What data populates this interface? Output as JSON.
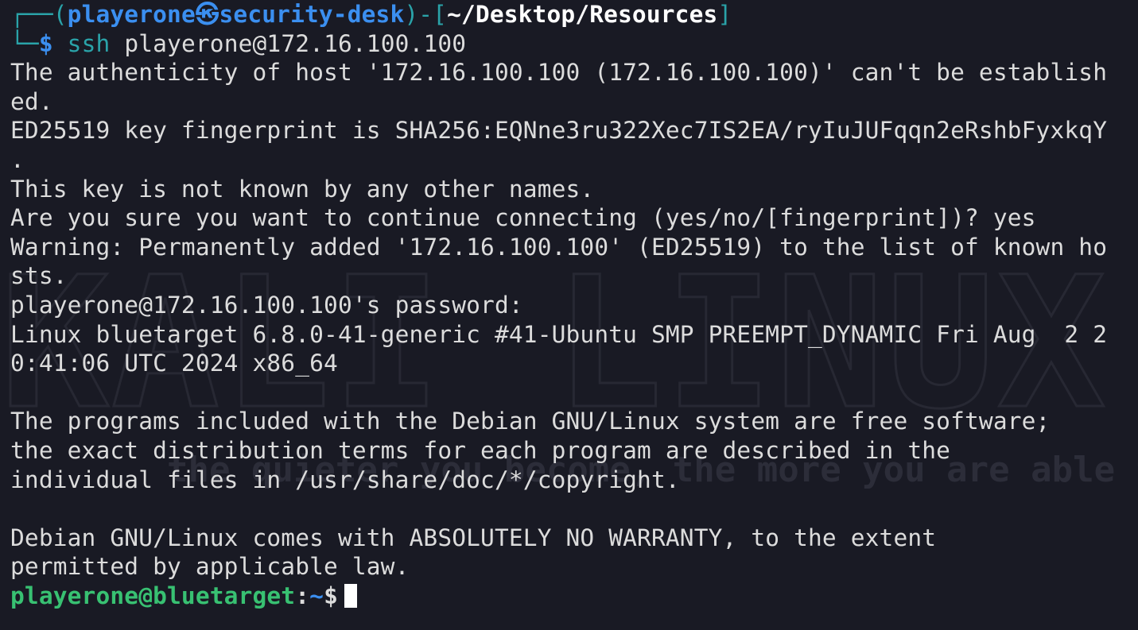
{
  "background_watermark": {
    "logo_text": "KALI LINUX",
    "tagline_text": "the quieter you become, the more you are able to hear"
  },
  "prompt": {
    "box_open": "┌──(",
    "user": "playerone",
    "skull": "㉿",
    "host": "security-desk",
    "box_mid": ")-[",
    "path": "~/Desktop/Resources",
    "box_close": "]",
    "box_bottom": "└─",
    "dollar": "$",
    "command_name": "ssh",
    "command_args": "playerone@172.16.100.100"
  },
  "output_lines": [
    "The authenticity of host '172.16.100.100 (172.16.100.100)' can't be establish",
    "ed.",
    "ED25519 key fingerprint is SHA256:EQNne3ru322Xec7IS2EA/ryIuJUFqqn2eRshbFyxkqY",
    ".",
    "This key is not known by any other names.",
    "Are you sure you want to continue connecting (yes/no/[fingerprint])? yes",
    "Warning: Permanently added '172.16.100.100' (ED25519) to the list of known ho",
    "sts.",
    "playerone@172.16.100.100's password:",
    "Linux bluetarget 6.8.0-41-generic #41-Ubuntu SMP PREEMPT_DYNAMIC Fri Aug  2 2",
    "0:41:06 UTC 2024 x86_64",
    "",
    "The programs included with the Debian GNU/Linux system are free software;",
    "the exact distribution terms for each program are described in the",
    "individual files in /usr/share/doc/*/copyright.",
    "",
    "Debian GNU/Linux comes with ABSOLUTELY NO WARRANTY, to the extent",
    "permitted by applicable law."
  ],
  "remote_prompt": {
    "user_host": "playerone@bluetarget",
    "colon": ":",
    "path": "~",
    "dollar": "$"
  },
  "colors": {
    "background": "#191a24",
    "text": "#dcdcdc",
    "accent_blue": "#3b8ff0",
    "accent_teal": "#2aa3a9",
    "prompt_green": "#38c172"
  }
}
